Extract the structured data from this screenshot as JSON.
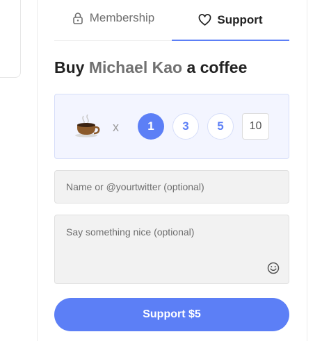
{
  "tabs": [
    {
      "label": "Membership",
      "icon": "lock-icon",
      "active": false
    },
    {
      "label": "Support",
      "icon": "heart-icon",
      "active": true
    }
  ],
  "heading": {
    "prefix": "Buy",
    "creator_name": "Michael Kao",
    "suffix": "a coffee"
  },
  "picker": {
    "item_icon": "coffee-cup-icon",
    "multiplier": "x",
    "options": [
      "1",
      "3",
      "5"
    ],
    "selected": "1",
    "custom_value": "10"
  },
  "form": {
    "name_placeholder": "Name or @yourtwitter (optional)",
    "message_placeholder": "Say something nice (optional)",
    "emoji_icon": "smiley-icon"
  },
  "submit": {
    "label": "Support $5"
  },
  "colors": {
    "accent": "#5c7ff6",
    "picker_bg": "#f3f5ff",
    "field_bg": "#f2f2f2"
  }
}
